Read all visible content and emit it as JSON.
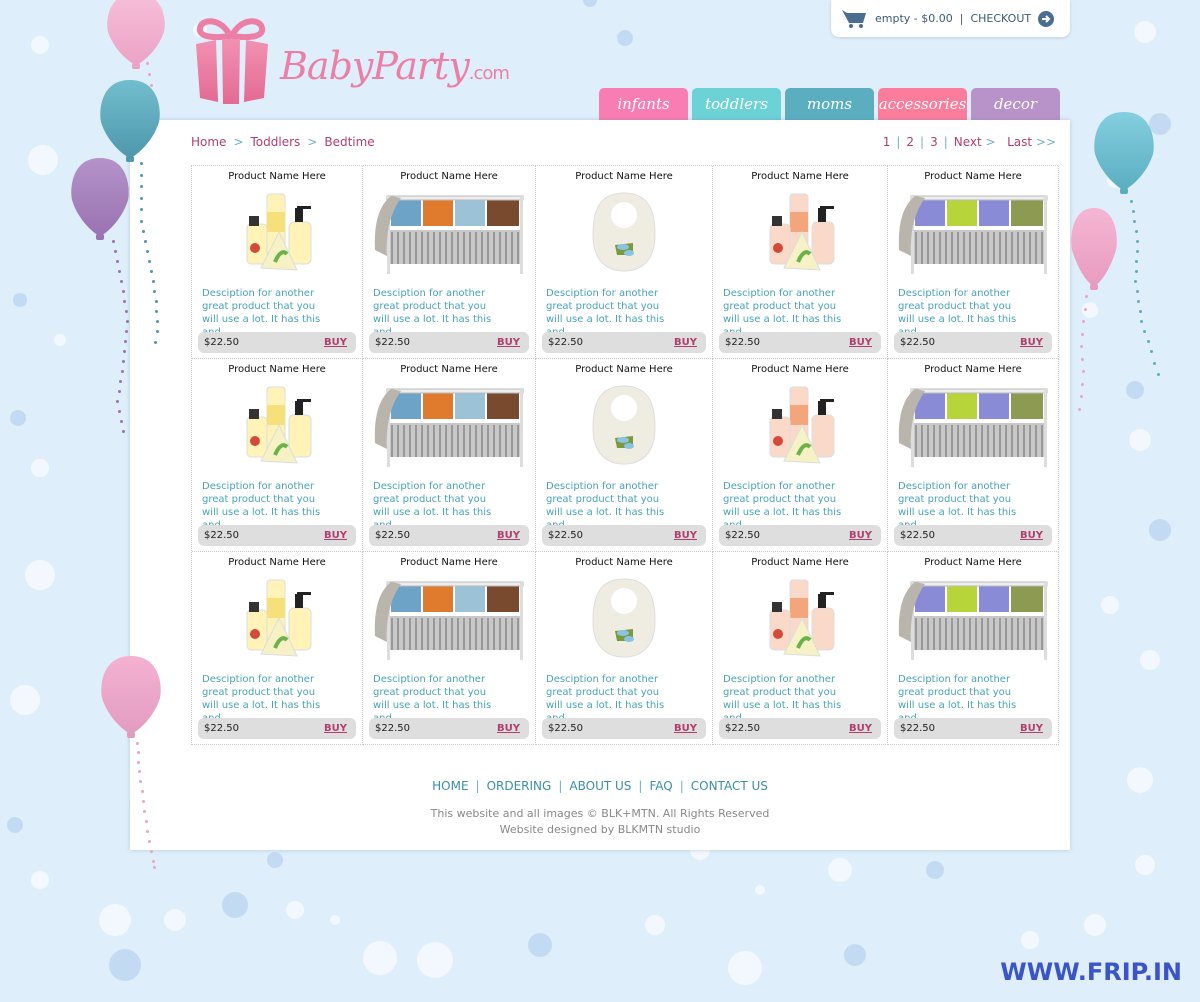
{
  "cart": {
    "icon": "cart-icon",
    "status": "empty - $0.00",
    "separator": "|",
    "checkout_label": "CHECKOUT",
    "arrow_icon": "arrow-right-circle-icon"
  },
  "logo": {
    "icon": "gift-box-icon",
    "name": "BabyParty",
    "suffix": ".com"
  },
  "nav": {
    "tabs": [
      {
        "label": "infants",
        "color": "#f77db2"
      },
      {
        "label": "toddlers",
        "color": "#6dd2d6"
      },
      {
        "label": "moms",
        "color": "#5aaec0"
      },
      {
        "label": "accessories",
        "color": "#fb7d9b"
      },
      {
        "label": "decor",
        "color": "#b893c9"
      }
    ]
  },
  "breadcrumb": {
    "items": [
      "Home",
      "Toddlers",
      "Bedtime"
    ],
    "separator": ">"
  },
  "pagination": {
    "pages": [
      "1",
      "2",
      "3"
    ],
    "next_label": "Next",
    "last_label": "Last",
    "next_glyph": ">",
    "last_glyph": ">>",
    "separator": "|"
  },
  "products": [
    {
      "name": "Product Name Here",
      "image": "bath-set",
      "tint": "yellow",
      "description": "Desciption for another great product that you will use a lot. It has this and ...",
      "price": "$22.50",
      "buy_label": "BUY"
    },
    {
      "name": "Product Name Here",
      "image": "crib",
      "tint": "orange-blue",
      "description": "Desciption for another great product that you will use a lot. It has this and ...",
      "price": "$22.50",
      "buy_label": "BUY"
    },
    {
      "name": "Product Name Here",
      "image": "bib",
      "tint": "cream",
      "description": "Desciption for another great product that you will use a lot. It has this and ...",
      "price": "$22.50",
      "buy_label": "BUY"
    },
    {
      "name": "Product Name Here",
      "image": "bath-set",
      "tint": "orange",
      "description": "Desciption for another great product that you will use a lot. It has this and ...",
      "price": "$22.50",
      "buy_label": "BUY"
    },
    {
      "name": "Product Name Here",
      "image": "crib",
      "tint": "purple-green",
      "description": "Desciption for another great product that you will use a lot. It has this and ...",
      "price": "$22.50",
      "buy_label": "BUY"
    },
    {
      "name": "Product Name Here",
      "image": "bath-set",
      "tint": "yellow",
      "description": "Desciption for another great product that you will use a lot. It has this and ...",
      "price": "$22.50",
      "buy_label": "BUY"
    },
    {
      "name": "Product Name Here",
      "image": "crib",
      "tint": "orange-blue",
      "description": "Desciption for another great product that you will use a lot. It has this and ...",
      "price": "$22.50",
      "buy_label": "BUY"
    },
    {
      "name": "Product Name Here",
      "image": "bib",
      "tint": "cream",
      "description": "Desciption for another great product that you will use a lot. It has this and ...",
      "price": "$22.50",
      "buy_label": "BUY"
    },
    {
      "name": "Product Name Here",
      "image": "bath-set",
      "tint": "orange",
      "description": "Desciption for another great product that you will use a lot. It has this and ...",
      "price": "$22.50",
      "buy_label": "BUY"
    },
    {
      "name": "Product Name Here",
      "image": "crib",
      "tint": "purple-green",
      "description": "Desciption for another great product that you will use a lot. It has this and ...",
      "price": "$22.50",
      "buy_label": "BUY"
    },
    {
      "name": "Product Name Here",
      "image": "bath-set",
      "tint": "yellow",
      "description": "Desciption for another great product that you will use a lot. It has this and ...",
      "price": "$22.50",
      "buy_label": "BUY"
    },
    {
      "name": "Product Name Here",
      "image": "crib",
      "tint": "orange-blue",
      "description": "Desciption for another great product that you will use a lot. It has this and ...",
      "price": "$22.50",
      "buy_label": "BUY"
    },
    {
      "name": "Product Name Here",
      "image": "bib",
      "tint": "cream",
      "description": "Desciption for another great product that you will use a lot. It has this and ...",
      "price": "$22.50",
      "buy_label": "BUY"
    },
    {
      "name": "Product Name Here",
      "image": "bath-set",
      "tint": "orange",
      "description": "Desciption for another great product that you will use a lot. It has this and ...",
      "price": "$22.50",
      "buy_label": "BUY"
    },
    {
      "name": "Product Name Here",
      "image": "crib",
      "tint": "purple-green",
      "description": "Desciption for another great product that you will use a lot. It has this and ...",
      "price": "$22.50",
      "buy_label": "BUY"
    }
  ],
  "footer": {
    "links": [
      "HOME",
      "ORDERING",
      "ABOUT US",
      "FAQ",
      "CONTACT US"
    ],
    "separator": "|",
    "copyright": "This website and all images © BLK+MTN. All Rights Reserved",
    "credit": "Website designed by BLKMTN studio"
  },
  "watermark": "WWW.FRIP.IN",
  "colors": {
    "accent_pink": "#b03e6f",
    "accent_teal": "#48a3b8",
    "background": "#dfeefb",
    "logo_pink": "#ec7fa6"
  }
}
